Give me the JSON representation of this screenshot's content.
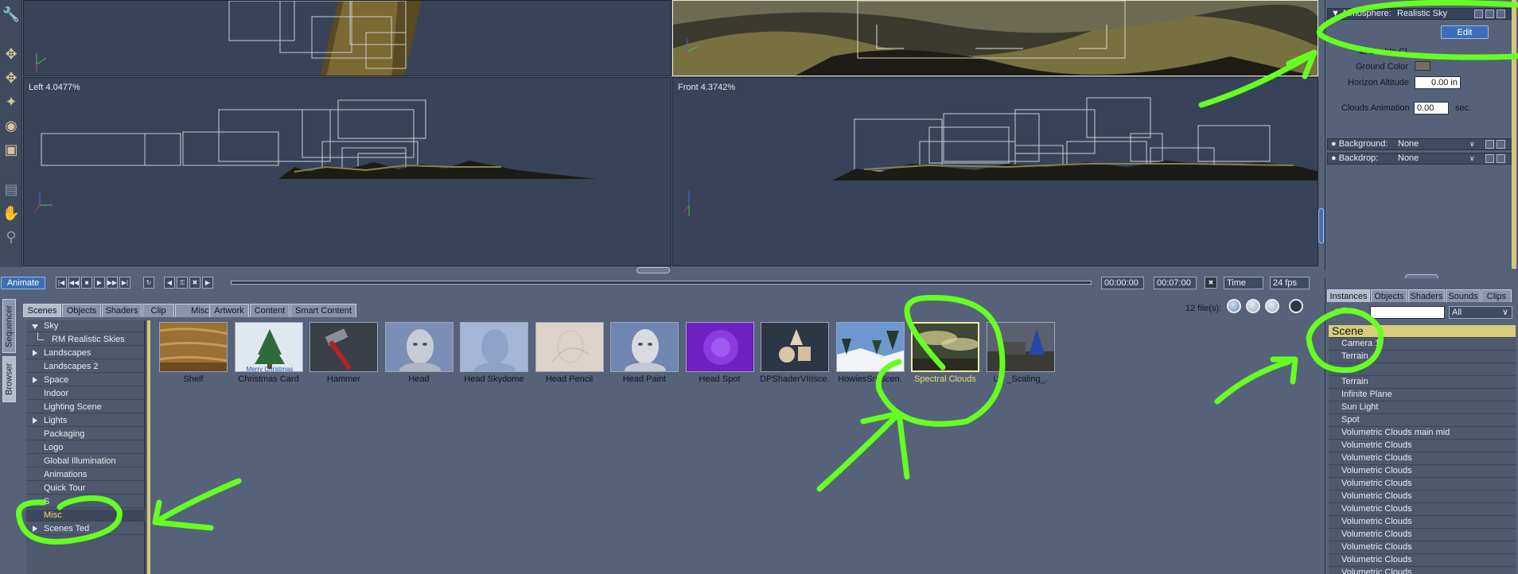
{
  "viewports": {
    "left_label": "Left 4.0477%",
    "front_label": "Front 4.3742%"
  },
  "timeline": {
    "animate_label": "Animate",
    "current_time": "00:00:00",
    "end_time": "00:07:00",
    "time_mode": "Time",
    "fps": "24 fps"
  },
  "browser": {
    "side_tabs": [
      "Sequencer",
      "Browser"
    ],
    "tabs": [
      "Scenes",
      "Objects",
      "Shaders",
      "Clip",
      "Misc.",
      "Artwork",
      "Content",
      "Smart Content"
    ],
    "file_count": "12 file(s):",
    "categories": [
      {
        "label": "Sky",
        "expand": "open"
      },
      {
        "label": "RM Realistic Skies",
        "expand": "child"
      },
      {
        "label": "Landscapes",
        "expand": "closed"
      },
      {
        "label": "Landscapes 2",
        "expand": "none"
      },
      {
        "label": "Space",
        "expand": "closed"
      },
      {
        "label": "Indoor",
        "expand": "none"
      },
      {
        "label": "Lighting Scene",
        "expand": "none"
      },
      {
        "label": "Lights",
        "expand": "closed"
      },
      {
        "label": "Packaging",
        "expand": "none"
      },
      {
        "label": "Logo",
        "expand": "none"
      },
      {
        "label": "Global Illumination",
        "expand": "none"
      },
      {
        "label": "Animations",
        "expand": "none"
      },
      {
        "label": "Quick Tour",
        "expand": "none"
      },
      {
        "label": "S",
        "expand": "none"
      },
      {
        "label": "Misc",
        "expand": "none",
        "selected": true
      },
      {
        "label": "Scenes Ted",
        "expand": "closed"
      }
    ],
    "items": [
      {
        "label": "Shelf",
        "thumb": "wood"
      },
      {
        "label": "Christmas Card",
        "thumb": "christmas",
        "caption": "Merry Christmas"
      },
      {
        "label": "Hammer",
        "thumb": "hammer"
      },
      {
        "label": "Head",
        "thumb": "head"
      },
      {
        "label": "Head Skydome",
        "thumb": "head-sky"
      },
      {
        "label": "Head Pencil",
        "thumb": "pencil"
      },
      {
        "label": "Head Paint",
        "thumb": "head-paint"
      },
      {
        "label": "Head Spot",
        "thumb": "spot"
      },
      {
        "label": "DPShaderVIIIsce.",
        "thumb": "shapes"
      },
      {
        "label": "HowiesSn  Scen.",
        "thumb": "snow"
      },
      {
        "label": "Spectral Clouds",
        "thumb": "clouds",
        "selected": true
      },
      {
        "label": "Up  _Scaling_.",
        "thumb": "scaling"
      }
    ]
  },
  "atmosphere": {
    "atmosphere_label": "Atmosphere:",
    "atmosphere_value": "Realistic Sky",
    "edit_label": "Edit",
    "enable_label": "Enable Cl",
    "ground_color_label": "Ground Color",
    "ground_color": "#7a6a62",
    "horizon_label": "Horizon Altitude",
    "horizon_value": "0.00 in",
    "clouds_anim_label": "Clouds Animation",
    "clouds_anim_value": "0.00",
    "clouds_anim_unit": "sec.",
    "background_label": "Background:",
    "background_value": "None",
    "backdrop_label": "Backdrop:",
    "backdrop_value": "None"
  },
  "instances": {
    "tabs": [
      "Instances",
      "Objects",
      "Shaders",
      "Sounds",
      "Clips"
    ],
    "filter_value": "All",
    "header": "Scene",
    "items": [
      "Camera 1",
      "Terrain",
      "",
      "Terrain",
      "Infinite Plane",
      "Sun Light",
      "Spot",
      "Volumetric Clouds main mid",
      "Volumetric Clouds",
      "Volumetric Clouds",
      "Volumetric Clouds",
      "Volumetric Clouds",
      "Volumetric Clouds",
      "Volumetric Clouds",
      "Volumetric Clouds",
      "Volumetric Clouds",
      "Volumetric Clouds",
      "Volumetric Clouds",
      "Volumetric Clouds"
    ]
  },
  "colors": {
    "annotation": "#66ff22",
    "selection": "#f0da6a",
    "panel": "#56627a"
  },
  "icons": [
    "hand-icon",
    "zoom-icon",
    "camera-icon",
    "rotate-icon",
    "move-icon"
  ]
}
